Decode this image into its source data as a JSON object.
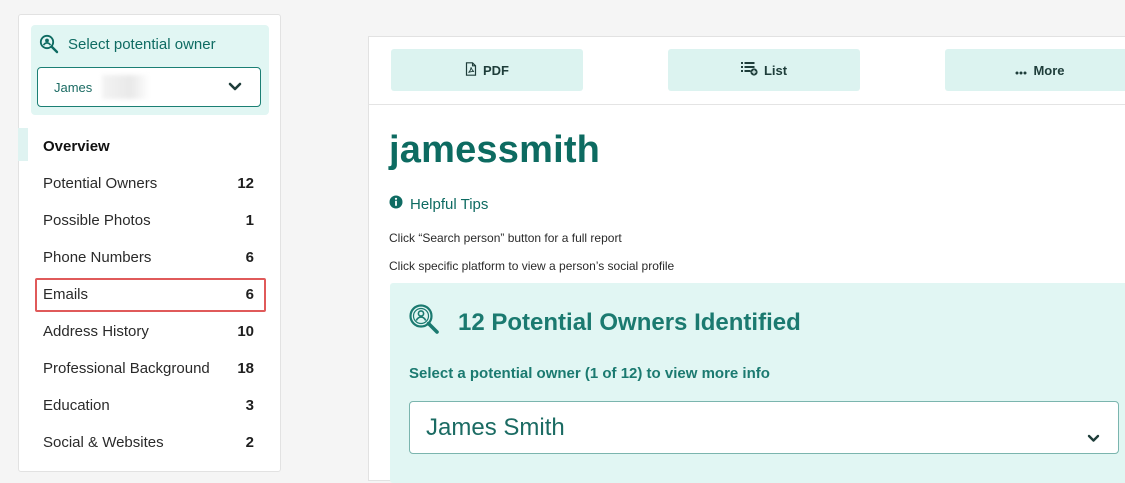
{
  "sidebar": {
    "owner_title": "Select potential owner",
    "selected_owner": "James",
    "items": [
      {
        "label": "Overview",
        "count": ""
      },
      {
        "label": "Potential Owners",
        "count": "12"
      },
      {
        "label": "Possible Photos",
        "count": "1"
      },
      {
        "label": "Phone Numbers",
        "count": "6"
      },
      {
        "label": "Emails",
        "count": "6"
      },
      {
        "label": "Address History",
        "count": "10"
      },
      {
        "label": "Professional Background",
        "count": "18"
      },
      {
        "label": "Education",
        "count": "3"
      },
      {
        "label": "Social & Websites",
        "count": "2"
      }
    ]
  },
  "toolbar": {
    "pdf_label": "PDF",
    "list_label": "List",
    "more_label": "More"
  },
  "main": {
    "username": "jamessmith",
    "tips_title": "Helpful Tips",
    "tip1": "Click “Search person” button for a full report",
    "tip2": "Click specific platform to view a person’s social profile",
    "identified_title": "12 Potential Owners Identified",
    "select_prompt": "Select a potential owner (1 of 12) to view more info",
    "selected_name": "James Smith"
  },
  "colors": {
    "accent": "#0d6b61",
    "light_panel": "#e1f6f3",
    "highlight_border": "#e05a5a"
  },
  "icons": {
    "owner_title": "magnifier-person-icon",
    "pdf": "pdf-file-icon",
    "list": "list-add-icon",
    "more": "ellipsis-icon",
    "tips": "info-icon",
    "identified": "magnifier-person-icon",
    "dropdown": "chevron-down-icon"
  }
}
